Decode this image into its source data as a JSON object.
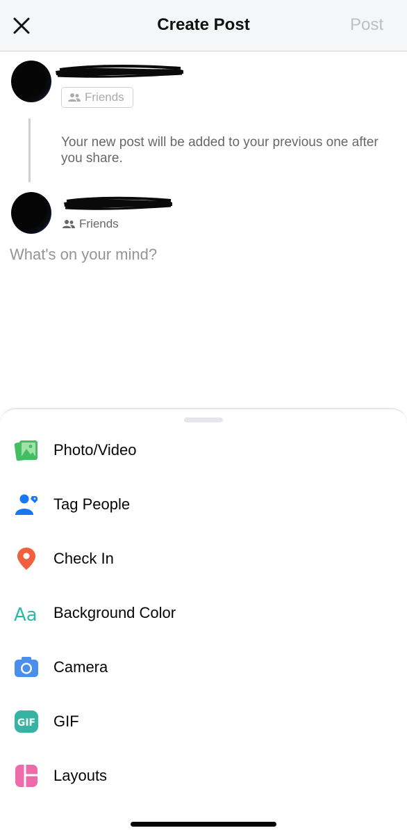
{
  "header": {
    "title": "Create Post",
    "post_label": "Post"
  },
  "previous_post": {
    "audience": "Friends",
    "notice": "Your new post will be added to your previous one after you share."
  },
  "new_post": {
    "audience": "Friends",
    "placeholder": "What's on your mind?",
    "value": ""
  },
  "menu": {
    "items": [
      {
        "label": "Photo/Video",
        "icon": "photo-video-icon",
        "color": "#45bd62"
      },
      {
        "label": "Tag People",
        "icon": "tag-people-icon",
        "color": "#1877f2"
      },
      {
        "label": "Check In",
        "icon": "location-pin-icon",
        "color": "#f5533d"
      },
      {
        "label": "Background Color",
        "icon": "text-aa-icon",
        "color": "#2abba7"
      },
      {
        "label": "Camera",
        "icon": "camera-icon",
        "color": "#3b82f6"
      },
      {
        "label": "GIF",
        "icon": "gif-icon",
        "color": "#2abba7"
      },
      {
        "label": "Layouts",
        "icon": "layouts-icon",
        "color": "#e84c9a"
      }
    ]
  }
}
